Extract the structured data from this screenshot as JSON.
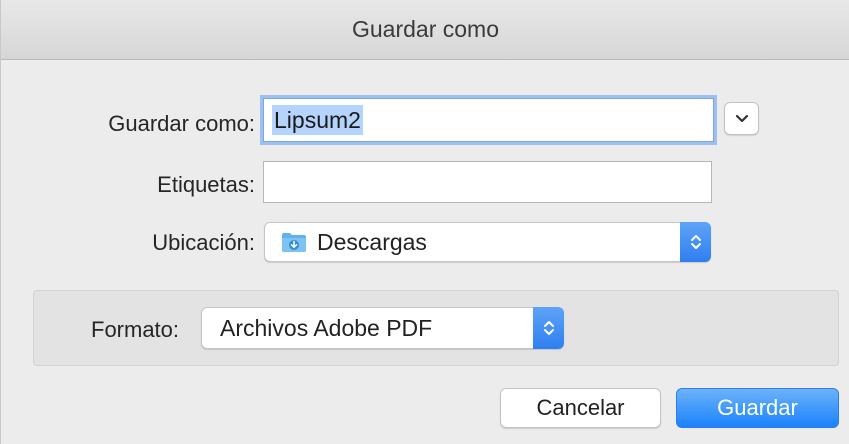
{
  "window": {
    "title": "Guardar como"
  },
  "form": {
    "save_as_label": "Guardar como:",
    "save_as_value": "Lipsum2",
    "tags_label": "Etiquetas:",
    "tags_value": "",
    "location_label": "Ubicación:",
    "location_value": "Descargas",
    "location_icon": "downloads-folder-icon"
  },
  "format": {
    "label": "Formato:",
    "value": "Archivos Adobe PDF"
  },
  "buttons": {
    "cancel": "Cancelar",
    "save": "Guardar"
  },
  "colors": {
    "accent": "#2f7ff0",
    "selection": "#b4d4fb",
    "focus_ring": "#9cc0f0",
    "folder": "#5fb2ee"
  }
}
